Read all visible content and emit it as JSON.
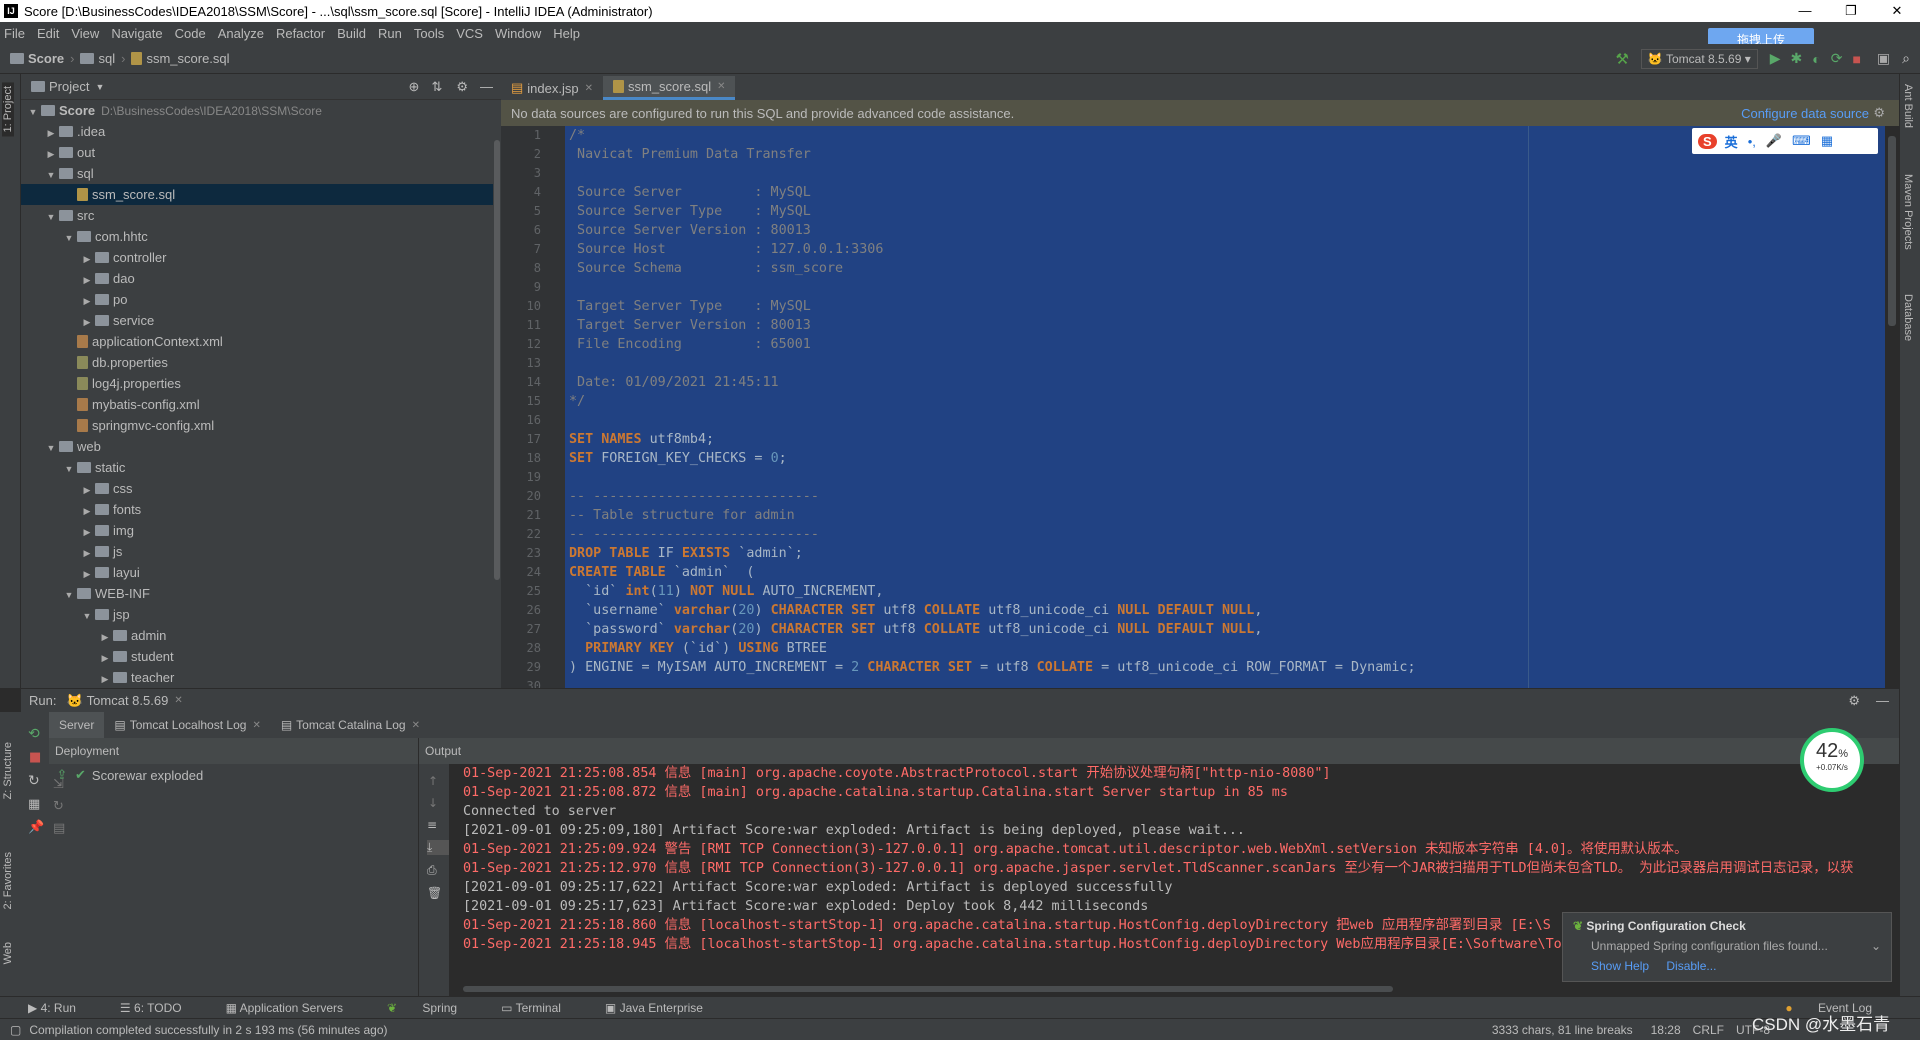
{
  "window": {
    "title": "Score [D:\\BusinessCodes\\IDEA2018\\SSM\\Score] - ...\\sql\\ssm_score.sql [Score] - IntelliJ IDEA (Administrator)",
    "logo": "IJ"
  },
  "menu": [
    "File",
    "Edit",
    "View",
    "Navigate",
    "Code",
    "Analyze",
    "Refactor",
    "Build",
    "Run",
    "Tools",
    "VCS",
    "Window",
    "Help"
  ],
  "breadcrumb": {
    "project": "Score",
    "folder": "sql",
    "file": "ssm_score.sql"
  },
  "toolbar": {
    "run_config": "Tomcat 8.5.69"
  },
  "upload_button": "拖拽上传",
  "left_tabs": {
    "project": "1: Project",
    "structure": "Z: Structure",
    "favorites": "2: Favorites",
    "web": "Web"
  },
  "right_tabs": {
    "ant": "Ant Build",
    "maven": "Maven Projects",
    "database": "Database"
  },
  "project_panel": {
    "title": "Project",
    "tree": [
      {
        "label": "Score",
        "hint": "D:\\BusinessCodes\\IDEA2018\\SSM\\Score",
        "depth": 0,
        "arrow": "▼",
        "icon": "folder",
        "bold": true
      },
      {
        "label": ".idea",
        "depth": 1,
        "arrow": "▶",
        "icon": "folder"
      },
      {
        "label": "out",
        "depth": 1,
        "arrow": "▶",
        "icon": "folder"
      },
      {
        "label": "sql",
        "depth": 1,
        "arrow": "▼",
        "icon": "folder"
      },
      {
        "label": "ssm_score.sql",
        "depth": 2,
        "arrow": "",
        "icon": "sql",
        "selected": true
      },
      {
        "label": "src",
        "depth": 1,
        "arrow": "▼",
        "icon": "folder"
      },
      {
        "label": "com.hhtc",
        "depth": 2,
        "arrow": "▼",
        "icon": "folder"
      },
      {
        "label": "controller",
        "depth": 3,
        "arrow": "▶",
        "icon": "folder"
      },
      {
        "label": "dao",
        "depth": 3,
        "arrow": "▶",
        "icon": "folder"
      },
      {
        "label": "po",
        "depth": 3,
        "arrow": "▶",
        "icon": "folder"
      },
      {
        "label": "service",
        "depth": 3,
        "arrow": "▶",
        "icon": "folder"
      },
      {
        "label": "applicationContext.xml",
        "depth": 2,
        "arrow": "",
        "icon": "xml"
      },
      {
        "label": "db.properties",
        "depth": 2,
        "arrow": "",
        "icon": "prop"
      },
      {
        "label": "log4j.properties",
        "depth": 2,
        "arrow": "",
        "icon": "prop"
      },
      {
        "label": "mybatis-config.xml",
        "depth": 2,
        "arrow": "",
        "icon": "xml"
      },
      {
        "label": "springmvc-config.xml",
        "depth": 2,
        "arrow": "",
        "icon": "xml"
      },
      {
        "label": "web",
        "depth": 1,
        "arrow": "▼",
        "icon": "folder"
      },
      {
        "label": "static",
        "depth": 2,
        "arrow": "▼",
        "icon": "folder"
      },
      {
        "label": "css",
        "depth": 3,
        "arrow": "▶",
        "icon": "folder"
      },
      {
        "label": "fonts",
        "depth": 3,
        "arrow": "▶",
        "icon": "folder"
      },
      {
        "label": "img",
        "depth": 3,
        "arrow": "▶",
        "icon": "folder"
      },
      {
        "label": "js",
        "depth": 3,
        "arrow": "▶",
        "icon": "folder"
      },
      {
        "label": "layui",
        "depth": 3,
        "arrow": "▶",
        "icon": "folder"
      },
      {
        "label": "WEB-INF",
        "depth": 2,
        "arrow": "▼",
        "icon": "folder"
      },
      {
        "label": "jsp",
        "depth": 3,
        "arrow": "▼",
        "icon": "folder"
      },
      {
        "label": "admin",
        "depth": 4,
        "arrow": "▶",
        "icon": "folder"
      },
      {
        "label": "student",
        "depth": 4,
        "arrow": "▶",
        "icon": "folder"
      },
      {
        "label": "teacher",
        "depth": 4,
        "arrow": "▶",
        "icon": "folder"
      }
    ]
  },
  "editor": {
    "tabs": [
      {
        "label": "index.jsp",
        "active": false
      },
      {
        "label": "ssm_score.sql",
        "active": true
      }
    ],
    "banner": "No data sources are configured to run this SQL and provide advanced code assistance.",
    "banner_link": "Configure data source",
    "lines": [
      [
        [
          "cm",
          "/*"
        ]
      ],
      [
        [
          "cm",
          " Navicat Premium Data Transfer"
        ]
      ],
      [
        [
          "cm",
          ""
        ]
      ],
      [
        [
          "cm",
          " Source Server         : MySQL"
        ]
      ],
      [
        [
          "cm",
          " Source Server Type    : MySQL"
        ]
      ],
      [
        [
          "cm",
          " Source Server Version : 80013"
        ]
      ],
      [
        [
          "cm",
          " Source Host           : 127.0.0.1:3306"
        ]
      ],
      [
        [
          "cm",
          " Source Schema         : ssm_score"
        ]
      ],
      [
        [
          "cm",
          ""
        ]
      ],
      [
        [
          "cm",
          " Target Server Type    : MySQL"
        ]
      ],
      [
        [
          "cm",
          " Target Server Version : 80013"
        ]
      ],
      [
        [
          "cm",
          " File Encoding         : 65001"
        ]
      ],
      [
        [
          "cm",
          ""
        ]
      ],
      [
        [
          "cm",
          " Date: 01/09/2021 21:45:11"
        ]
      ],
      [
        [
          "cm",
          "*/"
        ]
      ],
      [
        [
          "t",
          ""
        ]
      ],
      [
        [
          "kw",
          "SET NAMES"
        ],
        [
          "t",
          " utf8mb4;"
        ]
      ],
      [
        [
          "kw",
          "SET"
        ],
        [
          "t",
          " FOREIGN_KEY_CHECKS = "
        ],
        [
          "num",
          "0"
        ],
        [
          "t",
          ";"
        ]
      ],
      [
        [
          "t",
          ""
        ]
      ],
      [
        [
          "cm",
          "-- ----------------------------"
        ]
      ],
      [
        [
          "cm",
          "-- Table structure for admin"
        ]
      ],
      [
        [
          "cm",
          "-- ----------------------------"
        ]
      ],
      [
        [
          "kw",
          "DROP TABLE"
        ],
        [
          "t",
          " IF "
        ],
        [
          "kw",
          "EXISTS"
        ],
        [
          "t",
          " `admin`;"
        ]
      ],
      [
        [
          "kw",
          "CREATE TABLE"
        ],
        [
          "t",
          " `admin`  ("
        ]
      ],
      [
        [
          "t",
          "  `id` "
        ],
        [
          "kw",
          "int"
        ],
        [
          "t",
          "("
        ],
        [
          "num",
          "11"
        ],
        [
          "t",
          ") "
        ],
        [
          "kw",
          "NOT NULL"
        ],
        [
          "t",
          " AUTO_INCREMENT,"
        ]
      ],
      [
        [
          "t",
          "  `username` "
        ],
        [
          "kw",
          "varchar"
        ],
        [
          "t",
          "("
        ],
        [
          "num",
          "20"
        ],
        [
          "t",
          ") "
        ],
        [
          "kw",
          "CHARACTER SET"
        ],
        [
          "t",
          " utf8 "
        ],
        [
          "kw",
          "COLLATE"
        ],
        [
          "t",
          " utf8_unicode_ci "
        ],
        [
          "kw",
          "NULL DEFAULT NULL"
        ],
        [
          "t",
          ","
        ]
      ],
      [
        [
          "t",
          "  `password` "
        ],
        [
          "kw",
          "varchar"
        ],
        [
          "t",
          "("
        ],
        [
          "num",
          "20"
        ],
        [
          "t",
          ") "
        ],
        [
          "kw",
          "CHARACTER SET"
        ],
        [
          "t",
          " utf8 "
        ],
        [
          "kw",
          "COLLATE"
        ],
        [
          "t",
          " utf8_unicode_ci "
        ],
        [
          "kw",
          "NULL DEFAULT NULL"
        ],
        [
          "t",
          ","
        ]
      ],
      [
        [
          "t",
          "  "
        ],
        [
          "kw",
          "PRIMARY KEY"
        ],
        [
          "t",
          " (`id`) "
        ],
        [
          "kw",
          "USING"
        ],
        [
          "t",
          " BTREE"
        ]
      ],
      [
        [
          "t",
          ") ENGINE = MyISAM AUTO_INCREMENT = "
        ],
        [
          "num",
          "2"
        ],
        [
          "t",
          " "
        ],
        [
          "kw",
          "CHARACTER SET"
        ],
        [
          "t",
          " = utf8 "
        ],
        [
          "kw",
          "COLLATE"
        ],
        [
          "t",
          " = utf8_unicode_ci ROW_FORMAT = Dynamic;"
        ]
      ],
      [
        [
          "t",
          ""
        ]
      ]
    ]
  },
  "ime": {
    "lang": "英",
    "punct": "•,",
    "mic": "🎤",
    "kbd": "⌨",
    "grid": "▦"
  },
  "run": {
    "label": "Run:",
    "config": "Tomcat 8.5.69",
    "tabs": [
      {
        "label": "Server",
        "active": true
      },
      {
        "label": "Tomcat Localhost Log",
        "active": false
      },
      {
        "label": "Tomcat Catalina Log",
        "active": false
      }
    ],
    "deployment_header": "Deployment",
    "deployment_item": "Scorewar exploded",
    "output_header": "Output",
    "output": [
      {
        "red": true,
        "text": "01-Sep-2021 21:25:08.854 信息 [main] org.apache.coyote.AbstractProtocol.start 开始协议处理句柄[\"http-nio-8080\"]"
      },
      {
        "red": true,
        "text": "01-Sep-2021 21:25:08.872 信息 [main] org.apache.catalina.startup.Catalina.start Server startup in 85 ms"
      },
      {
        "red": false,
        "text": "Connected to server"
      },
      {
        "red": false,
        "text": "[2021-09-01 09:25:09,180] Artifact Score:war exploded: Artifact is being deployed, please wait..."
      },
      {
        "red": true,
        "text": "01-Sep-2021 21:25:09.924 警告 [RMI TCP Connection(3)-127.0.0.1] org.apache.tomcat.util.descriptor.web.WebXml.setVersion 未知版本字符串 [4.0]。将使用默认版本。"
      },
      {
        "red": true,
        "text": "01-Sep-2021 21:25:12.970 信息 [RMI TCP Connection(3)-127.0.0.1] org.apache.jasper.servlet.TldScanner.scanJars 至少有一个JAR被扫描用于TLD但尚未包含TLD。 为此记录器启用调试日志记录，以获"
      },
      {
        "red": false,
        "text": "[2021-09-01 09:25:17,622] Artifact Score:war exploded: Artifact is deployed successfully"
      },
      {
        "red": false,
        "text": "[2021-09-01 09:25:17,623] Artifact Score:war exploded: Deploy took 8,442 milliseconds"
      },
      {
        "red": true,
        "text": "01-Sep-2021 21:25:18.860 信息 [localhost-startStop-1] org.apache.catalina.startup.HostConfig.deployDirectory 把web 应用程序部署到目录 [E:\\S"
      },
      {
        "red": true,
        "text": "01-Sep-2021 21:25:18.945 信息 [localhost-startStop-1] org.apache.catalina.startup.HostConfig.deployDirectory Web应用程序目录[E:\\Software\\To"
      }
    ]
  },
  "notification": {
    "title": "Spring Configuration Check",
    "body": "Unmapped Spring configuration files found...",
    "show_help": "Show Help",
    "disable": "Disable..."
  },
  "gauge": {
    "percent": "42",
    "unit": "%",
    "rate": "+0.07K/s"
  },
  "bottom_tabs": [
    "4: Run",
    "6: TODO",
    "Application Servers",
    "Spring",
    "Terminal",
    "Java Enterprise"
  ],
  "event_log": "Event Log",
  "status": {
    "message": "Compilation completed successfully in 2 s 193 ms (56 minutes ago)",
    "chars": "3333 chars, 81 line breaks",
    "position": "18:28",
    "line_sep": "CRLF",
    "encoding": "UTF-8"
  },
  "watermark": "CSDN @水墨石青"
}
